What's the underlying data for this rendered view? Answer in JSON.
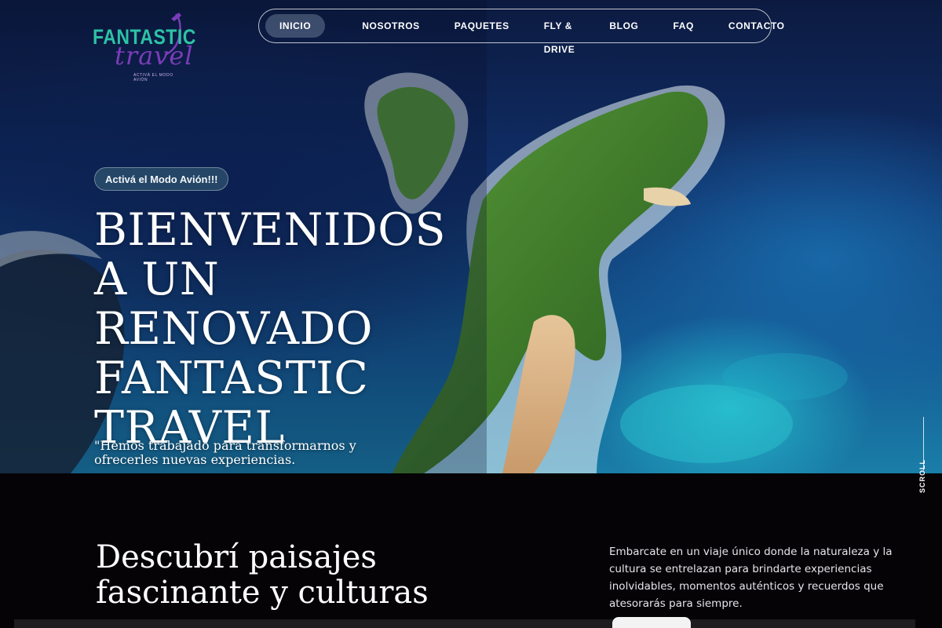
{
  "logo": {
    "line1": "FANTASTIC",
    "line2": "travel",
    "tagline": "ACTIVÁ EL MODO AVIÓN",
    "colors": {
      "teal": "#2dc2a6",
      "purple": "#7a3db8"
    }
  },
  "nav": {
    "items": [
      {
        "label": "INICIO",
        "active": true
      },
      {
        "label": "NOSOTROS"
      },
      {
        "label": "PAQUETES"
      },
      {
        "label": "FLY & DRIVE"
      },
      {
        "label": "BLOG"
      },
      {
        "label": "FAQ"
      },
      {
        "label": "CONTACTO"
      }
    ]
  },
  "hero": {
    "badge": "Activá el Modo Avión!!!",
    "title": "BIENVENIDOS A UN RENOVADO FANTASTIC TRAVEL",
    "quote": "\"Hemos trabajado para transformarnos y ofrecerles nuevas experiencias.",
    "scroll_label": "SCROLL"
  },
  "section": {
    "title": "Descubrí paisajes fascinante y culturas",
    "text": "Embarcate en un viaje único donde la naturaleza y la cultura se entrelazan para brindarte experiencias inolvidables, momentos auténticos y recuerdos que atesorarás para siempre."
  },
  "colors": {
    "hero_ocean_deep": "#0c1a40",
    "hero_ocean_light": "#1a7ea8",
    "island_green": "#3e7a2a",
    "section_bg": "#050306"
  }
}
